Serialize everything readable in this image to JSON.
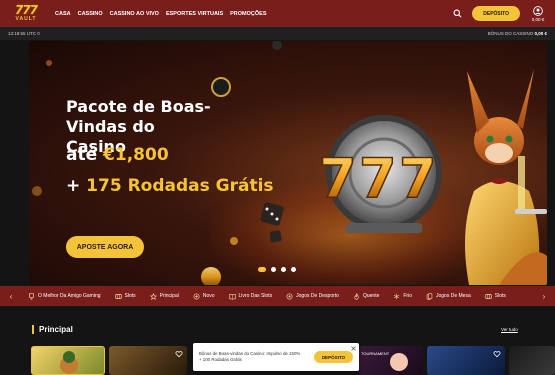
{
  "header": {
    "logo_number": "777",
    "logo_word": "VAULT",
    "nav": [
      "CASA",
      "CASSINO",
      "CASSINO AO VIVO",
      "ESPORTES VIRTUAIS",
      "PROMOÇÕES"
    ],
    "deposit_label": "DEPÓSITO",
    "balance": "0,00 €"
  },
  "infobar": {
    "time": "13:18:55 UTC 0",
    "bonus_label": "BÔNUS DO CASSINO",
    "bonus_value": "0,00 €"
  },
  "hero": {
    "title": "Pacote de Boas-Vindas do Casino",
    "line1_prefix": "até ",
    "line1_highlight": "€1,800",
    "line2_prefix": "+ ",
    "line2_highlight": "175 Rodadas Grátis",
    "cta": "APOSTE AGORA",
    "slides": 4,
    "active_slide": 0
  },
  "categories": [
    {
      "label": "O Melhor Da Amigo Gaming",
      "icon": "trophy-icon"
    },
    {
      "label": "Slots",
      "icon": "slot-icon"
    },
    {
      "label": "Principal",
      "icon": "star-icon"
    },
    {
      "label": "Novo",
      "icon": "sparkle-icon"
    },
    {
      "label": "Livro Das Slots",
      "icon": "book-icon"
    },
    {
      "label": "Jogos De Desporto",
      "icon": "ball-icon"
    },
    {
      "label": "Quente",
      "icon": "fire-icon"
    },
    {
      "label": "Frio",
      "icon": "snowflake-icon"
    },
    {
      "label": "Jogos De Mesa",
      "icon": "cards-icon"
    },
    {
      "label": "Slots",
      "icon": "slot-icon"
    }
  ],
  "section": {
    "title": "Principal",
    "see_all": "Ver tudo",
    "tile_badge": "TOURNAMENT"
  },
  "popup": {
    "text_line1": "Bônus de Boas-vindas do Casino: Impulso de 150%",
    "text_line2": "+ 100 Rodadas Grátis",
    "button": "DEPÓSITO"
  },
  "colors": {
    "brand_red": "#7a1e1c",
    "accent_yellow": "#f3c43a",
    "page_bg": "#141414"
  }
}
